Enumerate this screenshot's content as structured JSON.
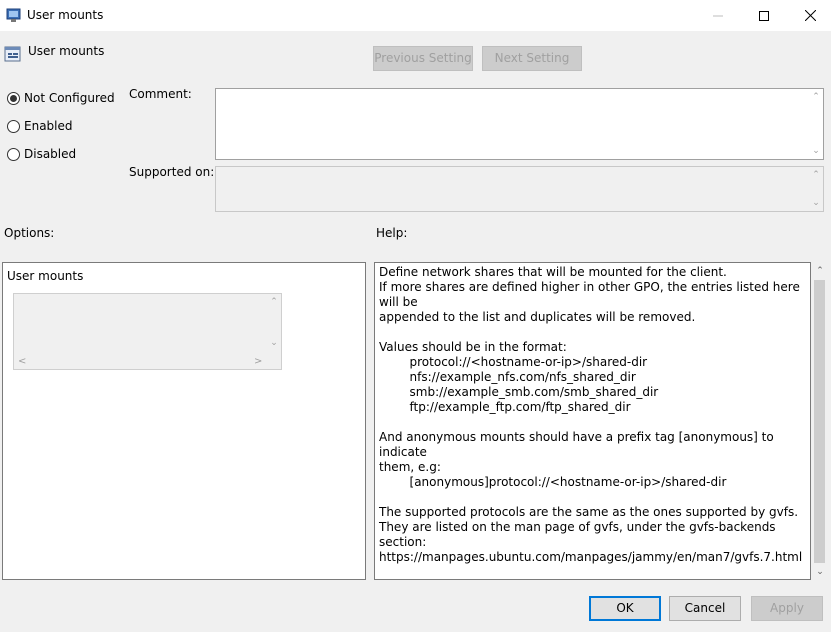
{
  "window": {
    "title": "User mounts",
    "controls": {
      "minimize": "–",
      "maximize": "☐",
      "close": "✕"
    }
  },
  "policy": {
    "name": "User mounts"
  },
  "nav": {
    "previous": "Previous Setting",
    "next": "Next Setting"
  },
  "state": {
    "options": [
      {
        "label": "Not Configured",
        "checked": true
      },
      {
        "label": "Enabled",
        "checked": false
      },
      {
        "label": "Disabled",
        "checked": false
      }
    ]
  },
  "fields": {
    "comment_label": "Comment:",
    "comment_value": "",
    "supported_label": "Supported on:",
    "supported_value": ""
  },
  "sections": {
    "options_label": "Options:",
    "help_label": "Help:"
  },
  "options_panel": {
    "title": "User mounts"
  },
  "help_text": "Define network shares that will be mounted for the client.\nIf more shares are defined higher in other GPO, the entries listed here will be\nappended to the list and duplicates will be removed.\n\nValues should be in the format:\n        protocol://<hostname-or-ip>/shared-dir\n        nfs://example_nfs.com/nfs_shared_dir\n        smb://example_smb.com/smb_shared_dir\n        ftp://example_ftp.com/ftp_shared_dir\n\nAnd anonymous mounts should have a prefix tag [anonymous] to indicate\nthem, e.g:\n        [anonymous]protocol://<hostname-or-ip>/shared-dir\n\nThe supported protocols are the same as the ones supported by gvfs.\nThey are listed on the man page of gvfs, under the gvfs-backends section:\nhttps://manpages.ubuntu.com/manpages/jammy/en/man7/gvfs.7.html\n\nIf an entry is not formatted accordingly, it will be ignored or an error may occur.",
  "buttons": {
    "ok": "OK",
    "cancel": "Cancel",
    "apply": "Apply"
  },
  "colors": {
    "accent": "#0078d7",
    "window_bg": "#f0f0f0"
  }
}
